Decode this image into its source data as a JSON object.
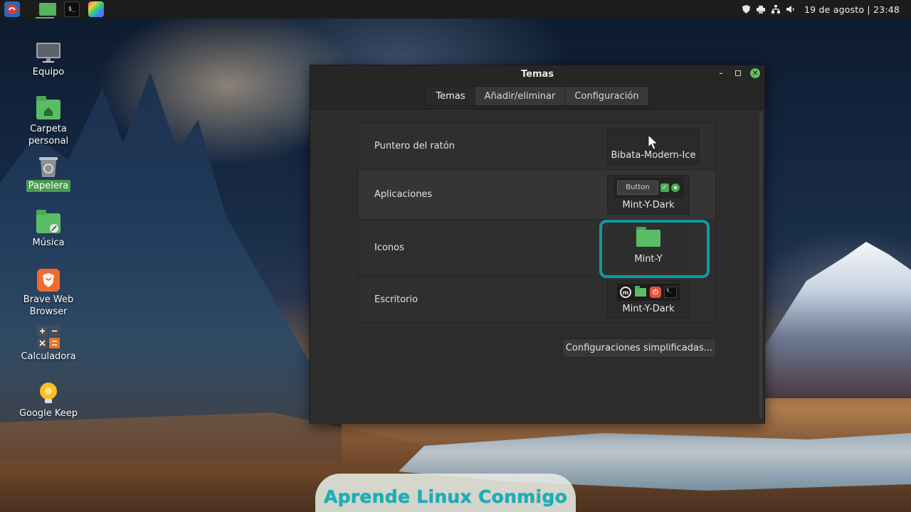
{
  "taskbar": {
    "launchers": [
      {
        "name": "menu-icon"
      },
      {
        "name": "files-icon"
      },
      {
        "name": "terminal-icon",
        "glyph": "$_"
      },
      {
        "name": "color-picker-icon"
      }
    ],
    "tray": {
      "icons": [
        "shield-icon",
        "printer-icon",
        "network-icon",
        "volume-icon"
      ],
      "clock": "19 de agosto | 23:48"
    }
  },
  "desktop": {
    "icons": [
      {
        "label": "Equipo",
        "icon": "computer-icon"
      },
      {
        "label": "Carpeta personal",
        "icon": "home-folder-icon"
      },
      {
        "label": "Papelera",
        "icon": "trash-icon",
        "selected": true
      },
      {
        "label": "Música",
        "icon": "music-folder-icon"
      },
      {
        "label": "Brave Web Browser",
        "icon": "brave-icon"
      },
      {
        "label": "Calculadora",
        "icon": "calculator-icon"
      },
      {
        "label": "Google Keep",
        "icon": "keep-icon"
      }
    ]
  },
  "window": {
    "title": "Temas",
    "controls": [
      "minimize-icon",
      "maximize-icon",
      "close-icon"
    ],
    "tabs": [
      {
        "label": "Temas",
        "active": true
      },
      {
        "label": "Añadir/eliminar",
        "active": false
      },
      {
        "label": "Configuración",
        "active": false
      }
    ],
    "rows": [
      {
        "label": "Puntero del ratón",
        "value": "Bibata-Modern-Ice"
      },
      {
        "label": "Aplicaciones",
        "value": "Mint-Y-Dark",
        "preview_button": "Button"
      },
      {
        "label": "Iconos",
        "value": "Mint-Y",
        "highlighted": true
      },
      {
        "label": "Escritorio",
        "value": "Mint-Y-Dark"
      }
    ],
    "simplified_button": "Configuraciones simplificadas..."
  },
  "watermark": "Aprende Linux Conmigo",
  "colors": {
    "accent_green": "#5fbf5b",
    "highlight_teal": "#0f9aa0",
    "watermark_text": "#17b0b8"
  }
}
